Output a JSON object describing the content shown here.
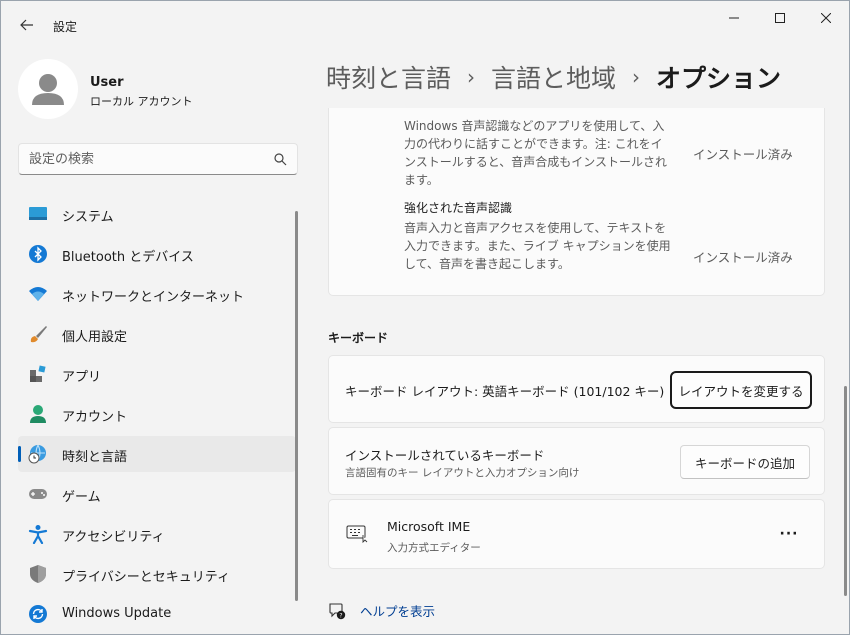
{
  "window": {
    "title": "設定"
  },
  "profile": {
    "name": "User",
    "account_type": "ローカル アカウント"
  },
  "search": {
    "placeholder": "設定の検索"
  },
  "sidebar": {
    "items": [
      {
        "label": "システム",
        "icon": "system-icon"
      },
      {
        "label": "Bluetooth とデバイス",
        "icon": "bluetooth-icon"
      },
      {
        "label": "ネットワークとインターネット",
        "icon": "wifi-icon"
      },
      {
        "label": "個人用設定",
        "icon": "brush-icon"
      },
      {
        "label": "アプリ",
        "icon": "apps-icon"
      },
      {
        "label": "アカウント",
        "icon": "account-icon"
      },
      {
        "label": "時刻と言語",
        "icon": "time-language-icon",
        "active": true
      },
      {
        "label": "ゲーム",
        "icon": "gamepad-icon"
      },
      {
        "label": "アクセシビリティ",
        "icon": "accessibility-icon"
      },
      {
        "label": "プライバシーとセキュリティ",
        "icon": "shield-icon"
      },
      {
        "label": "Windows Update",
        "icon": "update-icon"
      }
    ]
  },
  "breadcrumb": {
    "level1": "時刻と言語",
    "level2": "言語と地域",
    "current": "オプション"
  },
  "speech_features": [
    {
      "title": "",
      "description": "Windows 音声認識などのアプリを使用して、入力の代わりに話すことができます。注: これをインストールすると、音声合成もインストールされます。",
      "status": "インストール済み"
    },
    {
      "title": "強化された音声認識",
      "description": "音声入力と音声アクセスを使用して、テキストを入力できます。また、ライブ キャプションを使用して、音声を書き起こします。",
      "status": "インストール済み"
    }
  ],
  "keyboard": {
    "heading": "キーボード",
    "layout_label": "キーボード レイアウト: 英語キーボード (101/102 キー)",
    "change_layout_button": "レイアウトを変更する",
    "installed_title": "インストールされているキーボード",
    "installed_subtitle": "言語固有のキー レイアウトと入力オプション向け",
    "add_keyboard_button": "キーボードの追加",
    "ime_name": "Microsoft IME",
    "ime_subtitle": "入力方式エディター",
    "more_button": "···"
  },
  "help": {
    "label": "ヘルプを表示"
  },
  "colors": {
    "accent": "#005fb8",
    "link": "#003e92",
    "background": "#f3f3f3",
    "card": "#fbfbfb"
  }
}
